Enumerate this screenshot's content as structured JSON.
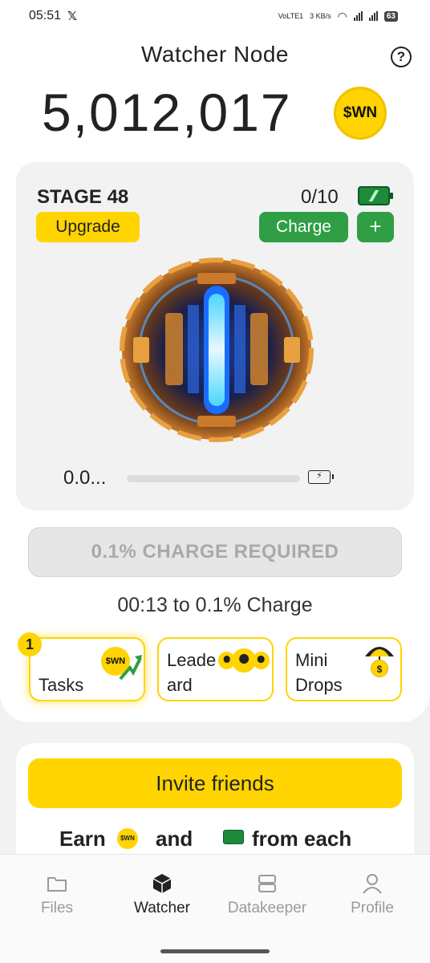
{
  "status_bar": {
    "time": "05:51",
    "network": "VoLTE1",
    "speed": "3 KB/s",
    "battery": "63"
  },
  "header": {
    "title": "Watcher Node",
    "balance": "5,012,017",
    "coin_label": "$WN"
  },
  "stage": {
    "label": "STAGE 48",
    "upgrade_label": "Upgrade",
    "charges": "0/10",
    "charge_label": "Charge",
    "plus_label": "+",
    "progress_text": "0.0...",
    "progress_fraction": 0.0
  },
  "charge_required_label": "0.1% CHARGE REQUIRED",
  "timer_text": "00:13 to 0.1% Charge",
  "tiles": [
    {
      "label_line1": "Tasks",
      "label_line2": "",
      "badge": "1"
    },
    {
      "label_line1": "Leade",
      "label_line2": "ard",
      "badge": ""
    },
    {
      "label_line1": "Mini",
      "label_line2": "Drops",
      "badge": ""
    }
  ],
  "invite": {
    "button_label": "Invite friends",
    "earn_prefix": "Earn",
    "earn_and": "and",
    "earn_suffix": "from each",
    "coin_label": "$WN"
  },
  "nav": [
    {
      "label": "Files",
      "icon": "folder-icon",
      "active": false
    },
    {
      "label": "Watcher",
      "icon": "cube-icon",
      "active": true
    },
    {
      "label": "Datakeeper",
      "icon": "server-icon",
      "active": false
    },
    {
      "label": "Profile",
      "icon": "user-icon",
      "active": false
    }
  ],
  "colors": {
    "accent_yellow": "#ffd400",
    "accent_green": "#2f9e44",
    "disabled_text": "#a9a9a9"
  }
}
